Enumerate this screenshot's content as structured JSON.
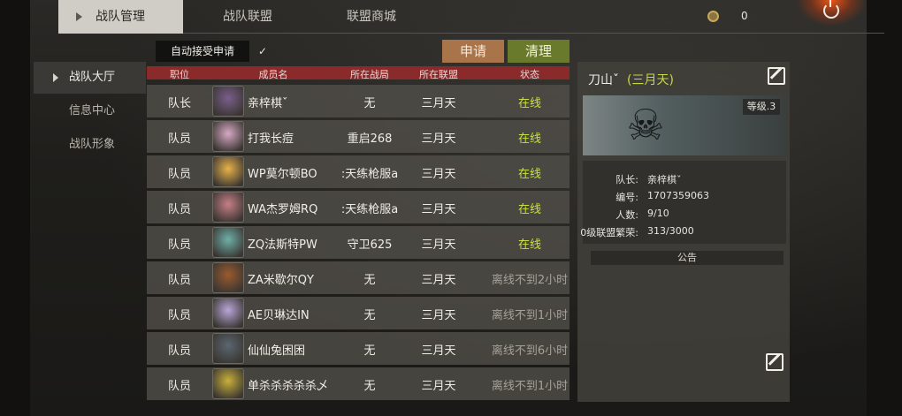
{
  "top_tabs": [
    "战队管理",
    "战队联盟",
    "联盟商城"
  ],
  "currency": "0",
  "sidebar": [
    "战队大厅",
    "信息中心",
    "战队形象"
  ],
  "auto_accept_label": "自动接受申请",
  "auto_accept_checked": "✓",
  "apply_label": "申请",
  "clean_label": "清理",
  "columns": [
    "职位",
    "成员名",
    "所在战局",
    "所在联盟",
    "状态"
  ],
  "members": [
    {
      "role": "队长",
      "name": "亲梓棋ˇ",
      "battle": "无",
      "alliance": "三月天",
      "status": "在线",
      "online": true
    },
    {
      "role": "队员",
      "name": "打我长痘",
      "battle": "重启268",
      "alliance": "三月天",
      "status": "在线",
      "online": true
    },
    {
      "role": "队员",
      "name": "WP莫尔顿BO",
      "battle": ":天练枪服a",
      "alliance": "三月天",
      "status": "在线",
      "online": true
    },
    {
      "role": "队员",
      "name": "WA杰罗姆RQ",
      "battle": ":天练枪服a",
      "alliance": "三月天",
      "status": "在线",
      "online": true
    },
    {
      "role": "队员",
      "name": "ZQ法斯特PW",
      "battle": "守卫625",
      "alliance": "三月天",
      "status": "在线",
      "online": true
    },
    {
      "role": "队员",
      "name": "ZA米歇尔QY",
      "battle": "无",
      "alliance": "三月天",
      "status": "离线不到2小时",
      "online": false
    },
    {
      "role": "队员",
      "name": "AE贝琳达IN",
      "battle": "无",
      "alliance": "三月天",
      "status": "离线不到1小时",
      "online": false
    },
    {
      "role": "队员",
      "name": "仙仙兔困困",
      "battle": "无",
      "alliance": "三月天",
      "status": "离线不到6小时",
      "online": false
    },
    {
      "role": "队员",
      "name": "单杀杀杀杀杀乄",
      "battle": "无",
      "alliance": "三月天",
      "status": "离线不到1小时",
      "online": false
    }
  ],
  "team": {
    "name": "刀山ˇ",
    "alliance": "(三月天)",
    "level": "等级.3",
    "captain_label": "队长:",
    "captain": "亲梓棋ˇ",
    "id_label": "编号:",
    "id": "1707359063",
    "count_label": "人数:",
    "count": "9/10",
    "prosperity_label": "0级联盟繁荣:",
    "prosperity": "313/3000",
    "notice_label": "公告"
  },
  "avatar_colors": [
    "#7a5e8c",
    "#d6a9c4",
    "#e8b24a",
    "#c67f86",
    "#6fb0a8",
    "#9a5a2e",
    "#b9a6d8",
    "#5a6670",
    "#c9b03a"
  ],
  "icons": {
    "coin": "coin-icon",
    "power": "power-icon",
    "edit": "edit-icon",
    "emblem": "skull-emblem"
  }
}
